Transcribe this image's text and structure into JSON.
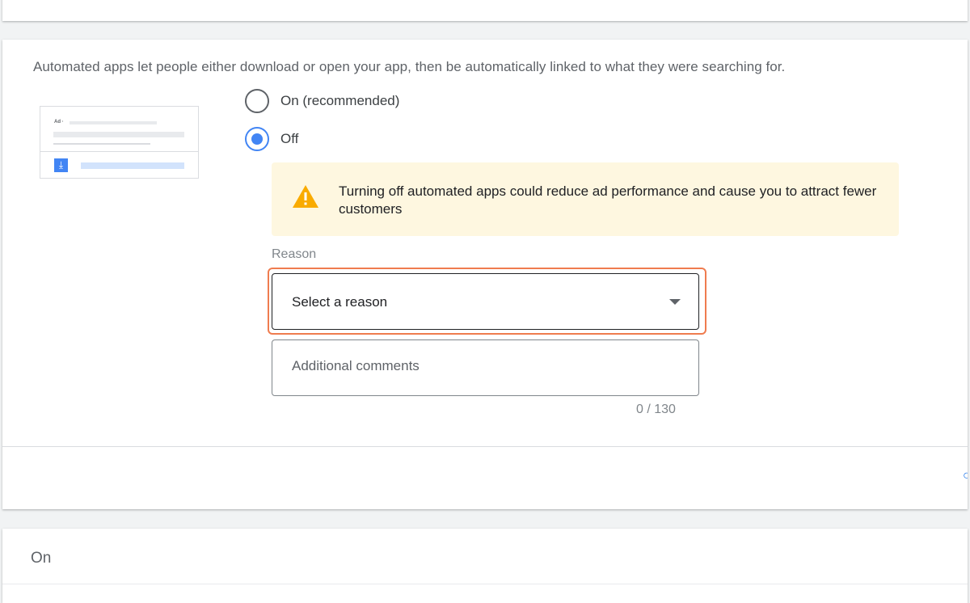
{
  "automated_apps": {
    "description": "Automated apps let people either download or open your app, then be automatically linked to what they were searching for.",
    "preview": {
      "ad_label": "Ad ·",
      "icon": "download-icon"
    },
    "options": [
      {
        "label": "On (recommended)",
        "selected": false
      },
      {
        "label": "Off",
        "selected": true
      }
    ],
    "warning": {
      "icon": "warning-triangle-icon",
      "text": "Turning off automated apps could reduce ad performance and cause you to attract fewer customers",
      "color": "#f9ab00"
    },
    "reason": {
      "label": "Reason",
      "select_value": "Select a reason"
    },
    "comments": {
      "placeholder": "Additional comments",
      "count": "0 / 130"
    }
  },
  "next_section": {
    "status": "On"
  },
  "colors": {
    "accent": "#4285f4",
    "highlight": "#ef7c4f",
    "warning_background": "#fef7e0"
  }
}
